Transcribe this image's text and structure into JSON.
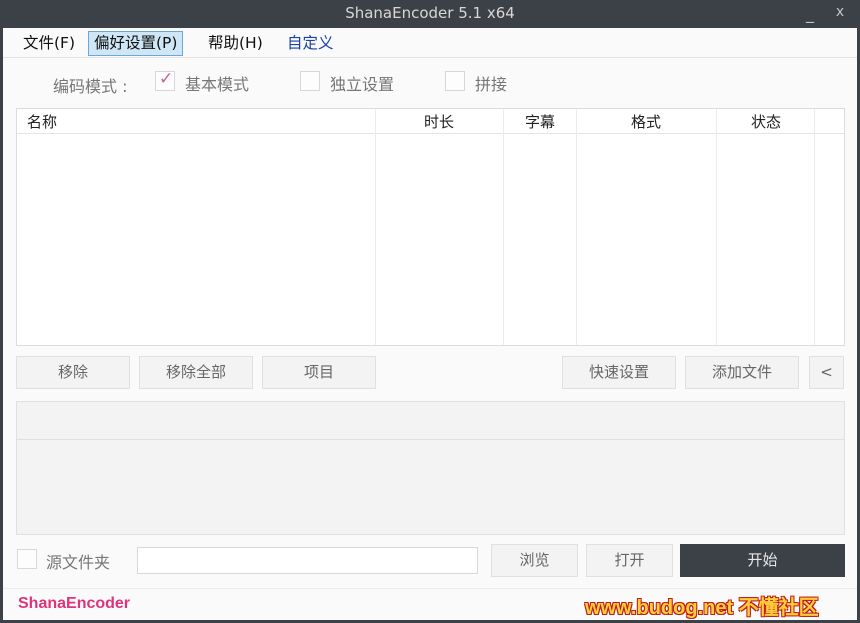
{
  "window": {
    "title": "ShanaEncoder 5.1 x64",
    "minimize_glyph": "_",
    "close_glyph": "x"
  },
  "menu": {
    "file": "文件(F)",
    "prefs": "偏好设置(P)",
    "help": "帮助(H)",
    "custom": "自定义"
  },
  "mode": {
    "label": "编码模式 :",
    "basic": {
      "label": "基本模式",
      "checked": true
    },
    "independent": {
      "label": "独立设置",
      "checked": false
    },
    "concat": {
      "label": "拼接",
      "checked": false
    }
  },
  "grid": {
    "columns": [
      "名称",
      "时长",
      "字幕",
      "格式",
      "状态"
    ],
    "rows": []
  },
  "buttons": {
    "remove": "移除",
    "remove_all": "移除全部",
    "item": "项目",
    "quick_settings": "快速设置",
    "add_file": "添加文件",
    "collapse": "<",
    "browse": "浏览",
    "open": "打开",
    "start": "开始"
  },
  "source": {
    "label": "源文件夹",
    "checked": false,
    "path": ""
  },
  "brand": "ShanaEncoder",
  "watermark": "www.budog.net 不懂社区",
  "colors": {
    "titlebar": "#3c4148",
    "accent": "#e0337c",
    "check": "#c8609a",
    "menu_active": "#cfe6f7"
  }
}
